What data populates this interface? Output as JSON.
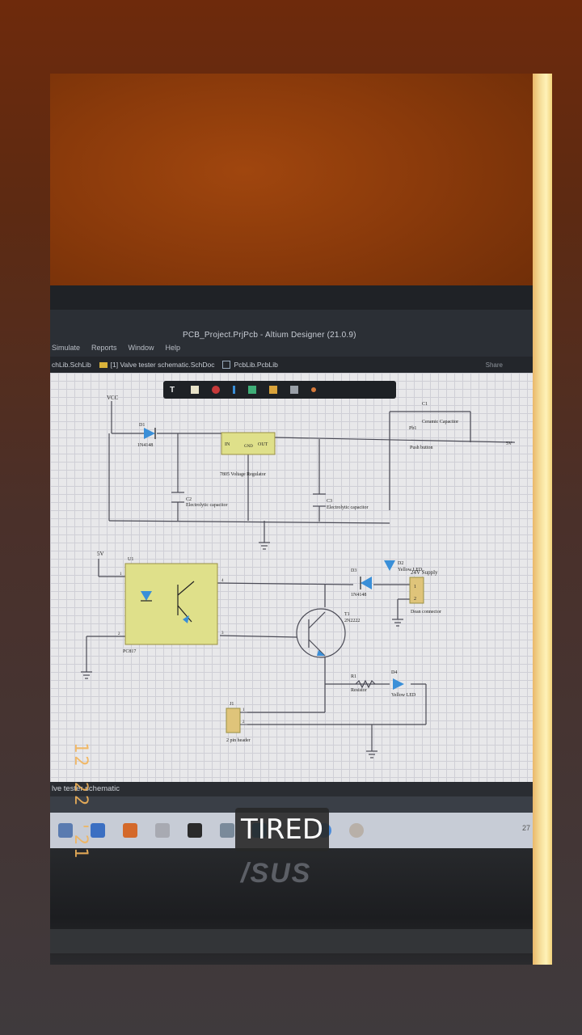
{
  "window": {
    "title": "PCB_Project.PrjPcb - Altium Designer (21.0.9)",
    "menu": [
      "Simulate",
      "Reports",
      "Window",
      "Help"
    ],
    "tabs": {
      "schlib": "chLib.SchLib",
      "active": "[1] Valve tester schematic.SchDoc",
      "pcblib": "PcbLib.PcbLib",
      "share": "Share"
    },
    "document_label": "lve tester schematic"
  },
  "schematic": {
    "vcc": "VCC",
    "d1_ref": "D1",
    "d1_part": "1N4148",
    "reg_in": "IN",
    "reg_gnd": "GND",
    "reg_out": "OUT",
    "reg_name": "7805 Voltage Regulator",
    "c1_ref": "C1",
    "c1_name": "Ceramic Capacitor",
    "pb1_ref": "Pb1",
    "pb1_name": "Push button",
    "out_5v": "5V",
    "c2_ref": "C2",
    "c2_name": "Electrolytic capacitor",
    "c3_ref": "C3",
    "c3_name": "Electrolytic capacitor",
    "d2_ref": "D2",
    "d2_name": "Yellow LED",
    "u1_5v": "5V",
    "u1_ref": "U1",
    "u1_part": "PC817",
    "pin1": "1",
    "pin2": "2",
    "pin3": "3",
    "pin4": "4",
    "d3_ref": "D3",
    "d3_part": "1N4148",
    "supply": "24V Supply",
    "conn_pin1": "1",
    "conn_pin2": "2",
    "conn_name": "Dean connector",
    "t1_ref": "T1",
    "t1_part": "2N2222",
    "r1_ref": "R1",
    "r1_name": "Resistor",
    "d4_ref": "D4",
    "d4_name": "Yellow LED",
    "j1_ref": "J1",
    "j1_pin1": "1",
    "j1_pin2": "2",
    "j1_name": "2 pin header"
  },
  "taskbar": {
    "clock": "27"
  },
  "laptop_brand": "/SUS",
  "datestamp": "12 22 '21",
  "sticker": "TIRED",
  "colors": {
    "wall": "#8a3a0b",
    "schematic_component": "#dfe08a",
    "diode": "#3a8fd8",
    "datestamp": "#f2b45a"
  }
}
